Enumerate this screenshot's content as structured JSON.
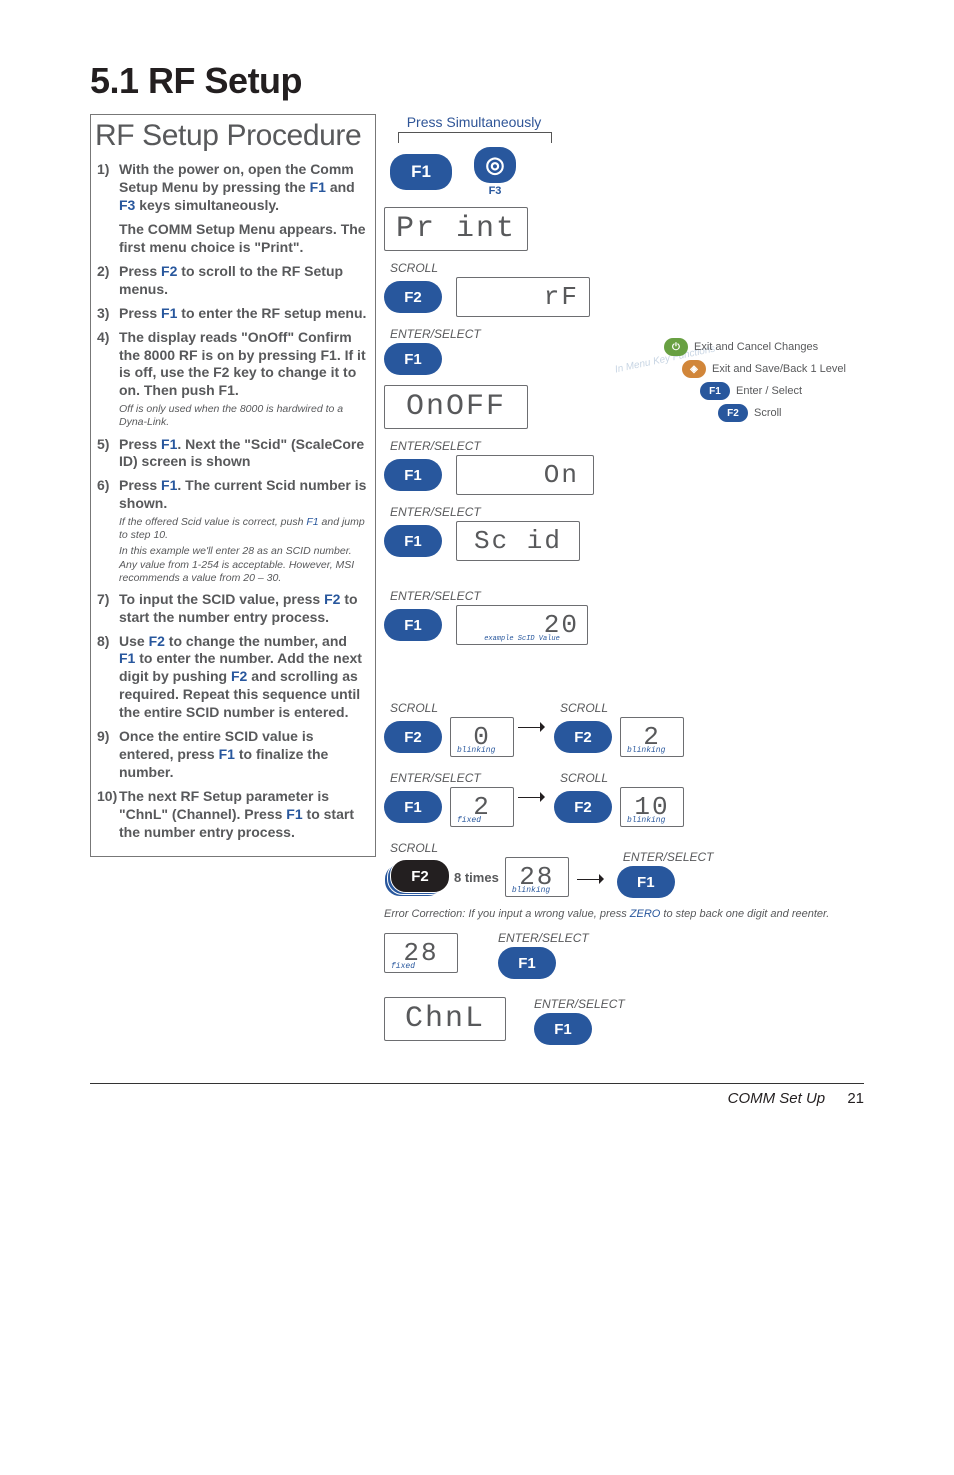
{
  "title": "5.1   RF Setup",
  "subtitle": "RF Setup Procedure",
  "press_sim": "Press Simultaneously",
  "f1": "F1",
  "f2": "F2",
  "f3": "F3",
  "lbl_scroll": "SCROLL",
  "lbl_enter": "ENTER/SELECT",
  "disp": {
    "print": "Pr int",
    "rf": "rF",
    "onoff": "OnOFF",
    "on": "On",
    "scid": "Sc id",
    "twenty": "20",
    "twenty_sub": "example ScID Value",
    "zero": "0",
    "two": "2",
    "ten": "10",
    "te": "28",
    "tech": "28",
    "chnl": "ChnL",
    "blinking": "blinking",
    "fixed": "fixed",
    "times": "8 times"
  },
  "legend": {
    "cancel": "Exit and Cancel Changes",
    "save": "Exit and Save/Back 1 Level",
    "enter": "Enter / Select",
    "scroll": "Scroll",
    "watermark": "In Menu Key Functions"
  },
  "steps": {
    "s1n": "1)",
    "s1a": "With the power on, open the Comm Setup Menu by pressing the ",
    "s1b": " and ",
    "s1c": " keys simultaneously.",
    "s1d": "The COMM Setup Menu appears. The first menu choice is \"Print\".",
    "s2n": "2)",
    "s2": "Press ",
    "s2b": " to scroll to the RF Setup menus.",
    "s3n": "3)",
    "s3a": "Press ",
    "s3b": " to enter the RF setup menu.",
    "s4n": "4)",
    "s4": "The display reads \"OnOff\" Confirm the 8000 RF is on by pressing F1. If it is off, use the F2 key to change it to on. Then push F1.",
    "s4note": "Off is only used when the 8000 is hardwired to a Dyna-Link.",
    "s5n": "5)",
    "s5a": "Press ",
    "s5b": ". Next the \"Scid\" (ScaleCore ID) screen is shown",
    "s6n": "6)",
    "s6a": "Press ",
    "s6b": ". The current Scid number is shown.",
    "s6note1": "If the offered Scid value is correct, push ",
    "s6note1b": " and jump to step 10.",
    "s6note2": "In this example we'll enter 28 as an SCID number. Any value from 1-254 is acceptable. However, MSI recommends a value from 20 – 30.",
    "s7n": "7)",
    "s7a": "To input the SCID value, press ",
    "s7b": "  to start the number entry process.",
    "s8n": "8)",
    "s8a": "Use ",
    "s8b": " to change the number, and ",
    "s8c": " to enter the number. Add the next digit by pushing ",
    "s8d": " and scrolling as required. Repeat this sequence until the entire SCID number is entered.",
    "s9n": "9)",
    "s9a": "Once the entire SCID value is entered, press ",
    "s9b": " to finalize the number.",
    "s10n": "10)",
    "s10a": "The next RF Setup parameter is \"ChnL\" (Channel). Press ",
    "s10b": " to start the number entry process."
  },
  "err": {
    "a": "Error Correction: If you input a wrong value, press ",
    "zero": "ZERO",
    "b": " to step back one digit and reenter."
  },
  "footer": {
    "label": "COMM Set Up",
    "page": "21"
  }
}
